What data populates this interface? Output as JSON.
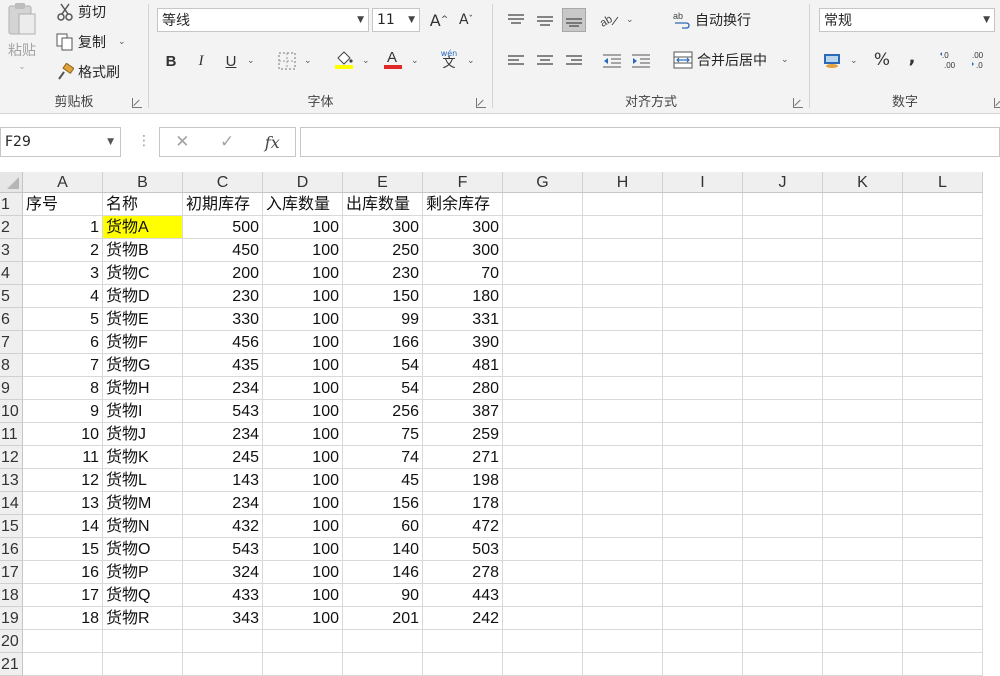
{
  "ribbon": {
    "clipboard": {
      "paste_label": "粘贴",
      "cut_label": "剪切",
      "copy_label": "复制",
      "format_painter_label": "格式刷",
      "group_label": "剪贴板"
    },
    "font": {
      "font_name": "等线",
      "font_size": "11",
      "bold": "B",
      "italic": "I",
      "underline": "U",
      "fill_color": "#ffff00",
      "font_color": "#e02a2a",
      "wen_label": "wén",
      "wen_char": "文",
      "group_label": "字体"
    },
    "alignment": {
      "wrap_text_label": "自动换行",
      "merge_center_label": "合并后居中",
      "group_label": "对齐方式"
    },
    "number": {
      "format": "常规",
      "percent": "%",
      "comma": ",",
      "group_label": "数字"
    }
  },
  "formula_bar": {
    "name_box": "F29",
    "cancel": "✕",
    "enter": "✓",
    "fx": "fx",
    "content": ""
  },
  "sheet": {
    "columns": [
      "A",
      "B",
      "C",
      "D",
      "E",
      "F",
      "G",
      "H",
      "I",
      "J",
      "K",
      "L"
    ],
    "rows": [
      "1",
      "2",
      "3",
      "4",
      "5",
      "6",
      "7",
      "8",
      "9",
      "10",
      "11",
      "12",
      "13",
      "14",
      "15",
      "16",
      "17",
      "18",
      "19",
      "20",
      "21"
    ],
    "header_row": [
      "序号",
      "名称",
      "初期库存",
      "入库数量",
      "出库数量",
      "剩余库存"
    ],
    "data": [
      [
        "1",
        "货物A",
        "500",
        "100",
        "300",
        "300"
      ],
      [
        "2",
        "货物B",
        "450",
        "100",
        "250",
        "300"
      ],
      [
        "3",
        "货物C",
        "200",
        "100",
        "230",
        "70"
      ],
      [
        "4",
        "货物D",
        "230",
        "100",
        "150",
        "180"
      ],
      [
        "5",
        "货物E",
        "330",
        "100",
        "99",
        "331"
      ],
      [
        "6",
        "货物F",
        "456",
        "100",
        "166",
        "390"
      ],
      [
        "7",
        "货物G",
        "435",
        "100",
        "54",
        "481"
      ],
      [
        "8",
        "货物H",
        "234",
        "100",
        "54",
        "280"
      ],
      [
        "9",
        "货物I",
        "543",
        "100",
        "256",
        "387"
      ],
      [
        "10",
        "货物J",
        "234",
        "100",
        "75",
        "259"
      ],
      [
        "11",
        "货物K",
        "245",
        "100",
        "74",
        "271"
      ],
      [
        "12",
        "货物L",
        "143",
        "100",
        "45",
        "198"
      ],
      [
        "13",
        "货物M",
        "234",
        "100",
        "156",
        "178"
      ],
      [
        "14",
        "货物N",
        "432",
        "100",
        "60",
        "472"
      ],
      [
        "15",
        "货物O",
        "543",
        "100",
        "140",
        "503"
      ],
      [
        "16",
        "货物P",
        "324",
        "100",
        "146",
        "278"
      ],
      [
        "17",
        "货物Q",
        "433",
        "100",
        "90",
        "443"
      ],
      [
        "18",
        "货物R",
        "343",
        "100",
        "201",
        "242"
      ]
    ],
    "highlight_color": "#ffff00"
  }
}
